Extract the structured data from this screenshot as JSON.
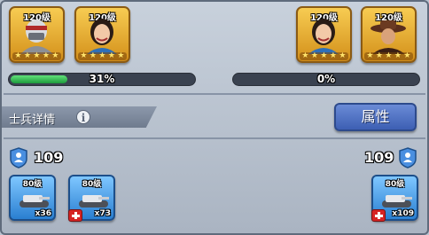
{
  "heroes_left": [
    {
      "level": "120级",
      "stars": 5,
      "portrait": "masked-soldier"
    },
    {
      "level": "120级",
      "stars": 5,
      "portrait": "girl"
    }
  ],
  "heroes_right": [
    {
      "level": "120级",
      "stars": 5,
      "portrait": "girl"
    },
    {
      "level": "120级",
      "stars": 5,
      "portrait": "cowboy"
    }
  ],
  "progress_left": {
    "label": "31%",
    "value": 0.31
  },
  "progress_right": {
    "label": "0%",
    "value": 0.0
  },
  "section": {
    "title": "士兵详情",
    "info_icon": "info-icon"
  },
  "attr_button": {
    "label": "属性"
  },
  "troops_left": {
    "count": "109"
  },
  "troops_right": {
    "count": "109"
  },
  "units_left": [
    {
      "level": "80级",
      "qty": "x36",
      "healing": false
    },
    {
      "level": "80级",
      "qty": "x73",
      "healing": true
    }
  ],
  "units_right": [
    {
      "level": "80级",
      "qty": "x109",
      "healing": true
    }
  ],
  "colors": {
    "progress_fill": "#2fb84f",
    "button": "#4a6ec4",
    "hero_frame": "#e9a82a",
    "unit_frame": "#4aa3f0"
  }
}
